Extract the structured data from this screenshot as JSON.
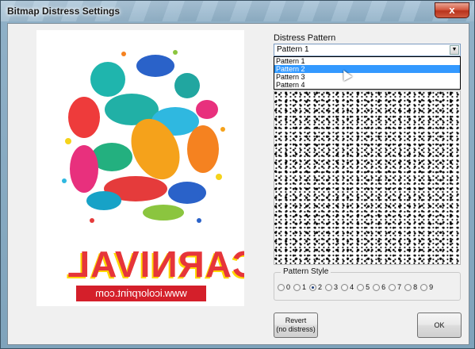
{
  "window": {
    "title": "Bitmap Distress Settings",
    "close_label": "x"
  },
  "preview": {
    "banner_text": "CARNIVAL",
    "url_text": "www.icolorprint.com"
  },
  "distress_pattern": {
    "label": "Distress Pattern",
    "selected": "Pattern 1",
    "options": [
      "Pattern 1",
      "Pattern 2",
      "Pattern 3",
      "Pattern 4"
    ],
    "highlighted_index": 1
  },
  "pattern_style": {
    "label": "Pattern Style",
    "options": [
      "0",
      "1",
      "2",
      "3",
      "4",
      "5",
      "6",
      "7",
      "8",
      "9"
    ],
    "selected": "2"
  },
  "buttons": {
    "revert_line1": "Revert",
    "revert_line2": "(no distress)",
    "ok": "OK"
  },
  "colors": {
    "accent": "#3399ff",
    "banner_red": "#e6353a",
    "url_strip": "#d41f2a"
  }
}
